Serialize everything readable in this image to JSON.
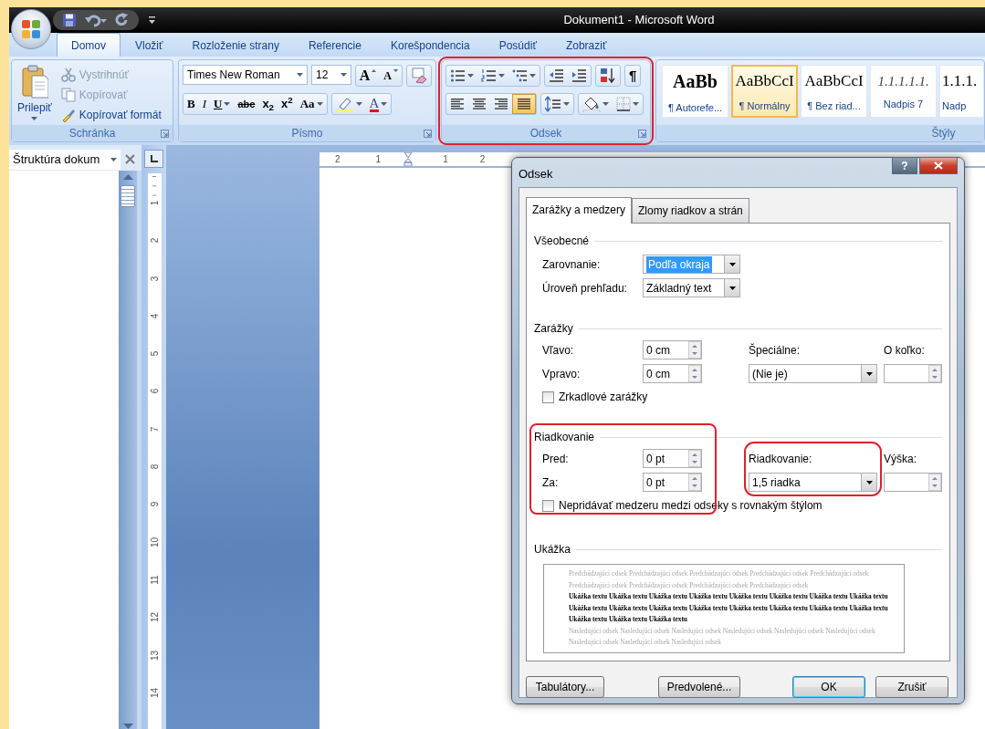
{
  "window": {
    "title": "Dokument1 - Microsoft Word"
  },
  "ribbon_tabs": [
    {
      "label": "Domov",
      "selected": true
    },
    {
      "label": "Vložiť",
      "selected": false
    },
    {
      "label": "Rozloženie strany",
      "selected": false
    },
    {
      "label": "Referencie",
      "selected": false
    },
    {
      "label": "Korešpondencia",
      "selected": false
    },
    {
      "label": "Posúdiť",
      "selected": false
    },
    {
      "label": "Zobraziť",
      "selected": false
    }
  ],
  "ribbon": {
    "clipboard": {
      "label": "Schránka",
      "paste": "Prilepiť",
      "items": [
        {
          "label": "Vystrihnúť",
          "kind": "cut",
          "disabled": true
        },
        {
          "label": "Kopírovať",
          "kind": "copy",
          "disabled": true
        },
        {
          "label": "Kopírovať formát",
          "kind": "brush",
          "disabled": false
        }
      ]
    },
    "font": {
      "label": "Písmo",
      "font_name": "Times New Roman",
      "font_size": "12",
      "grow": "A",
      "shrink": "A",
      "format_buttons": [
        {
          "label": "B",
          "kind": "bold",
          "dropdown": false
        },
        {
          "label": "I",
          "kind": "italic",
          "dropdown": false
        },
        {
          "label": "U",
          "kind": "underline",
          "dropdown": true
        },
        {
          "label": "abc",
          "kind": "strike",
          "dropdown": false
        },
        {
          "label": "x$_{2}$",
          "kind": "plain",
          "dropdown": false
        },
        {
          "label": "x$^{2}$",
          "kind": "plain",
          "dropdown": false
        },
        {
          "label": "Aa",
          "kind": "serif",
          "dropdown": true
        }
      ],
      "font_color": "A"
    },
    "paragraph": {
      "label": "Odsek",
      "highlighted": true,
      "show_marks": "¶",
      "alignments": [
        {
          "kind": "left",
          "selected": false
        },
        {
          "kind": "center",
          "selected": false
        },
        {
          "kind": "right",
          "selected": false
        },
        {
          "kind": "justify",
          "selected": true
        }
      ]
    },
    "styles": {
      "label": "Štýly",
      "items": [
        {
          "preview": "AaBb",
          "name": "¶ Autorefe...",
          "kind": "bold",
          "selected": false
        },
        {
          "preview": "AaBbCcI",
          "name": "¶ Normálny",
          "kind": "plain",
          "selected": true
        },
        {
          "preview": "AaBbCcI",
          "name": "¶ Bez riad...",
          "kind": "plain",
          "selected": false
        },
        {
          "preview": "1.1.1.1.1.",
          "name": "Nadpis 7",
          "kind": "italic",
          "selected": false
        },
        {
          "preview": "1.1.1.",
          "name": "Nadp",
          "kind": "plain",
          "selected": false
        }
      ]
    }
  },
  "navigation_pane": {
    "title": "Štruktúra dokum"
  },
  "rulers": {
    "horizontal": [
      "2",
      "1",
      "1",
      "2"
    ],
    "vertical": [
      "1",
      "2",
      "3",
      "4",
      "5",
      "6",
      "7",
      "8",
      "9",
      "10",
      "11",
      "12",
      "13",
      "14"
    ]
  },
  "dialog": {
    "title": "Odsek",
    "help": "?",
    "tabs": [
      {
        "label": "Zarážky a medzery",
        "selected": true
      },
      {
        "label": "Zlomy riadkov a strán",
        "selected": false
      }
    ],
    "general": {
      "legend": "Všeobecné",
      "fields": [
        {
          "label": "Zarovnanie:",
          "value": "Podľa okraja",
          "focused": true
        },
        {
          "label": "Úroveň prehľadu:",
          "value": "Základný text",
          "focused": false
        }
      ]
    },
    "indentation": {
      "legend": "Zarážky",
      "left": {
        "label": "Vľavo:",
        "value": "0 cm"
      },
      "right": {
        "label": "Vpravo:",
        "value": "0 cm"
      },
      "special": {
        "label": "Špeciálne:",
        "value": "(Nie je)",
        "highlighted": false
      },
      "by": {
        "label": "O koľko:"
      },
      "checkbox": {
        "label": "Zrkadlové zarážky",
        "checked": false
      }
    },
    "spacing": {
      "legend": "Riadkovanie",
      "highlighted": true,
      "left": {
        "label": "Pred:",
        "value": "0 pt"
      },
      "right": {
        "label": "Za:",
        "value": "0 pt"
      },
      "special": {
        "label": "Riadkovanie:",
        "value": "1,5 riadka",
        "highlighted": true
      },
      "by": {
        "label": "Výška:"
      },
      "checkbox": {
        "label": "Nepridávať medzeru medzi odseky s rovnakým štýlom",
        "checked": false
      }
    },
    "preview": {
      "legend": "Ukážka",
      "previous": "Predchádzajúci odsek Predchádzajúci odsek Predchádzajúci odsek Predchádzajúci odsek Predchádzajúci odsek Predchádzajúci odsek Predchádzajúci odsek Predchádzajúci odsek Predchádzajúci odsek",
      "sample": "Ukážka textu Ukážka textu Ukážka textu Ukážka textu Ukážka textu Ukážka textu Ukážka textu Ukážka textu Ukážka textu Ukážka textu Ukážka textu Ukážka textu Ukážka textu Ukážka textu Ukážka textu Ukážka textu Ukážka textu Ukážka textu Ukážka textu",
      "next": "Nasledujúci odsek Nasledujúci odsek Nasledujúci odsek Nasledujúci odsek Nasledujúci odsek Nasledujúci odsek Nasledujúci odsek Nasledujúci odsek Nasledujúci odsek"
    },
    "buttons": [
      {
        "label": "Tabulátory...",
        "default": false
      },
      {
        "label": "Predvolené...",
        "default": false
      },
      {
        "label": "OK",
        "default": true
      },
      {
        "label": "Zrušiť",
        "default": false
      }
    ]
  }
}
